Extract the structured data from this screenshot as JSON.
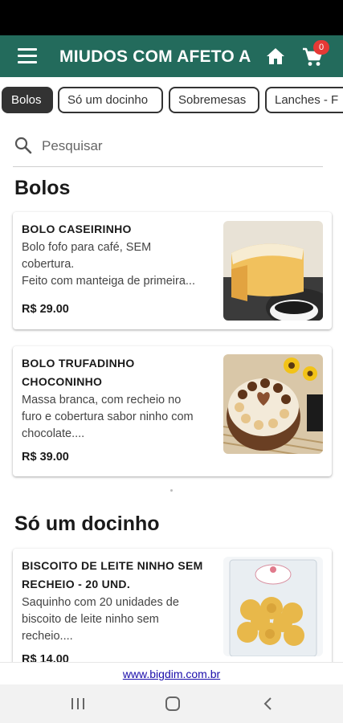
{
  "header": {
    "title": "MIUDOS COM AFETO A",
    "cart_count": "0",
    "accent_color": "#236b5c"
  },
  "categories": [
    {
      "label": "Bolos",
      "active": true
    },
    {
      "label": "Só um docinho",
      "active": false
    },
    {
      "label": "Sobremesas",
      "active": false
    },
    {
      "label": "Lanches - F",
      "active": false
    }
  ],
  "search": {
    "placeholder": "Pesquisar"
  },
  "sections": [
    {
      "title": "Bolos",
      "products": [
        {
          "name": "BOLO CASEIRINHO",
          "description_lines": [
            "Bolo fofo para café, SEM",
            "cobertura.",
            "Feito com manteiga de primeira..."
          ],
          "price": "R$ 29.00",
          "image": "bolo-caseirinho-photo"
        },
        {
          "name_lines": [
            "BOLO TRUFADINHO",
            "CHOCONINHO"
          ],
          "description_lines": [
            "Massa branca, com recheio no",
            "furo e cobertura sabor ninho com",
            "chocolate...."
          ],
          "price": "R$ 39.00",
          "image": "bolo-trufadinho-photo"
        }
      ]
    },
    {
      "title": "Só um docinho",
      "products": [
        {
          "name_lines": [
            "BISCOITO DE LEITE NINHO SEM",
            "RECHEIO - 20 UND."
          ],
          "description_lines": [
            "Saquinho com 20 unidades de",
            "biscoito de leite ninho sem",
            "recheio...."
          ],
          "price": "R$ 14.00",
          "image": "biscoito-leite-ninho-photo"
        }
      ]
    }
  ],
  "footer": {
    "link_text": "www.bigdim.com.br"
  },
  "system_nav": {
    "icons": [
      "recents-icon",
      "home-circle-icon",
      "back-icon"
    ]
  }
}
